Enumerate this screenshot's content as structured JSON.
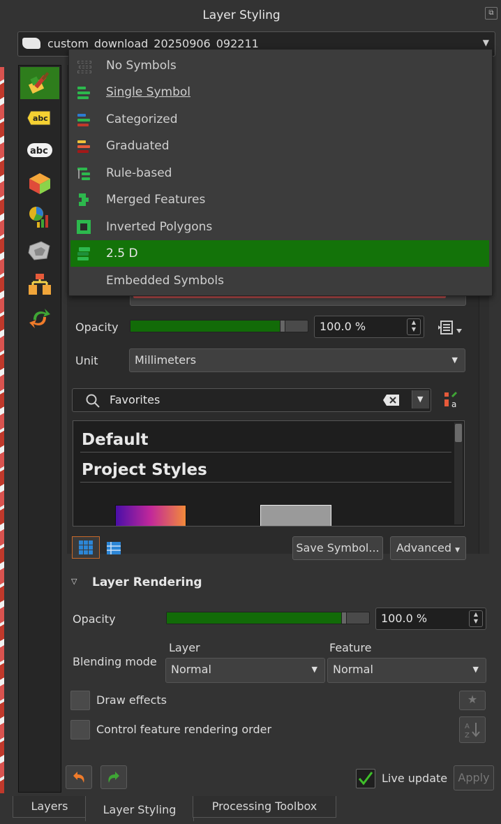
{
  "panel": {
    "title": "Layer Styling"
  },
  "layer_selector": {
    "value": "custom_download_20250906_092211"
  },
  "renderer_menu": {
    "items": [
      {
        "label": "No Symbols",
        "icon": "no-symbols-icon",
        "selected": false,
        "highlighted": false
      },
      {
        "label": "Single Symbol",
        "icon": "single-symbol-icon",
        "selected": true,
        "highlighted": false
      },
      {
        "label": "Categorized",
        "icon": "categorized-icon",
        "selected": false,
        "highlighted": false
      },
      {
        "label": "Graduated",
        "icon": "graduated-icon",
        "selected": false,
        "highlighted": false
      },
      {
        "label": "Rule-based",
        "icon": "rule-based-icon",
        "selected": false,
        "highlighted": false
      },
      {
        "label": "Merged Features",
        "icon": "merged-features-icon",
        "selected": false,
        "highlighted": false
      },
      {
        "label": "Inverted Polygons",
        "icon": "inverted-polygons-icon",
        "selected": false,
        "highlighted": false
      },
      {
        "label": "2.5 D",
        "icon": "two-five-d-icon",
        "selected": false,
        "highlighted": true
      },
      {
        "label": "Embedded Symbols",
        "icon": "",
        "selected": false,
        "highlighted": false
      }
    ]
  },
  "symbol": {
    "opacity_label": "Opacity",
    "opacity_value": "100.0 %",
    "opacity_fraction": 1.0,
    "unit_label": "Unit",
    "unit_value": "Millimeters",
    "search_value": "Favorites",
    "library_groups": [
      "Default",
      "Project Styles"
    ],
    "save_symbol_button": "Save Symbol...",
    "advanced_button": "Advanced"
  },
  "layer_rendering": {
    "section_title": "Layer Rendering",
    "opacity_label": "Opacity",
    "opacity_value": "100.0 %",
    "opacity_fraction": 1.0,
    "blending_label": "Blending mode",
    "layer_label": "Layer",
    "feature_label": "Feature",
    "layer_blend_value": "Normal",
    "feature_blend_value": "Normal",
    "draw_effects_label": "Draw effects",
    "draw_effects_checked": false,
    "control_order_label": "Control feature rendering order",
    "control_order_checked": false
  },
  "footer": {
    "live_update_label": "Live update",
    "live_update_checked": true,
    "apply_button": "Apply"
  },
  "bottom_tabs": [
    {
      "label": "Layers",
      "active": false
    },
    {
      "label": "Layer Styling",
      "active": true
    },
    {
      "label": "Processing Toolbox",
      "active": false
    }
  ],
  "colors": {
    "accent_green": "#137309",
    "slider_fill": "#126b08",
    "background": "#333333"
  }
}
